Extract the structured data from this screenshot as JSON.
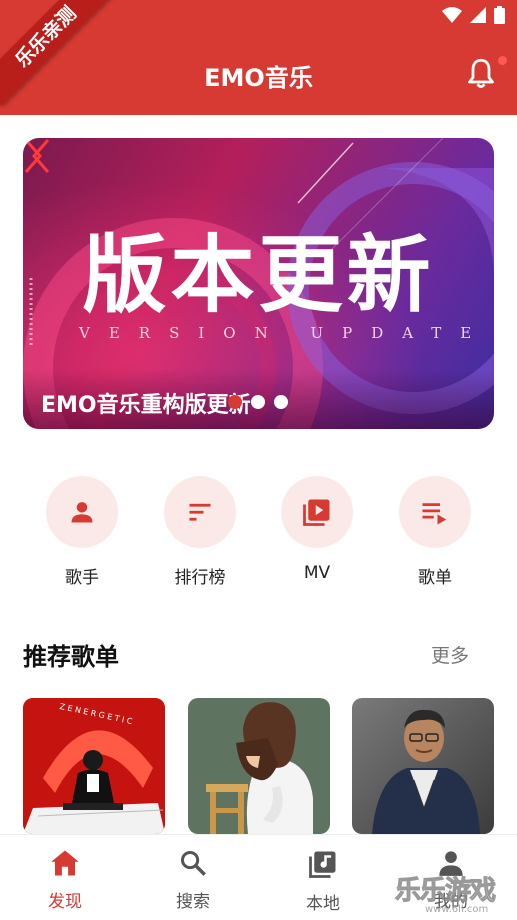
{
  "header": {
    "title": "EMO音乐",
    "ribbon": "乐乐亲测",
    "has_notification_dot": true,
    "color": "#d63a33"
  },
  "banner": {
    "headline": "版本更新",
    "subheadline": "VERSION UPDATE",
    "caption": "EMO音乐重构版更新",
    "slides_count": 3,
    "active_slide": 1
  },
  "categories": [
    {
      "label": "歌手",
      "icon": "person-icon"
    },
    {
      "label": "排行榜",
      "icon": "sort-icon"
    },
    {
      "label": "MV",
      "icon": "video-library-icon"
    },
    {
      "label": "歌单",
      "icon": "playlist-play-icon"
    }
  ],
  "recommend": {
    "title": "推荐歌单",
    "more_label": "更多"
  },
  "bottom_nav": [
    {
      "label": "发现",
      "icon": "home-icon",
      "active": true
    },
    {
      "label": "搜索",
      "icon": "search-icon",
      "active": false
    },
    {
      "label": "本地",
      "icon": "library-music-icon",
      "active": false
    },
    {
      "label": "我的",
      "icon": "account-icon",
      "active": false
    }
  ],
  "watermark": {
    "text": "乐乐游戏",
    "url": "www.6ll.com"
  }
}
